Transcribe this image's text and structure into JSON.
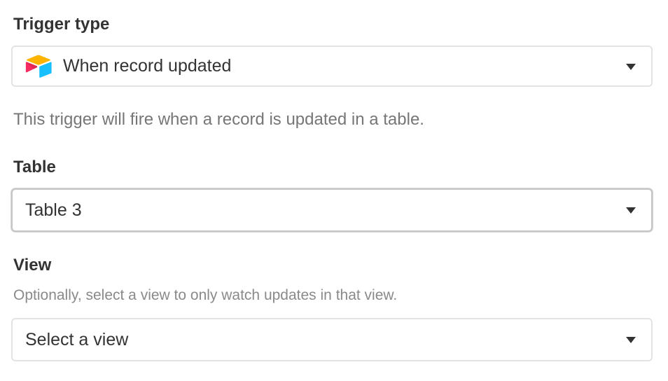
{
  "trigger": {
    "label": "Trigger type",
    "selected": "When record updated",
    "icon": "airtable-logo-icon",
    "description": "This trigger will fire when a record is updated in a table."
  },
  "table": {
    "label": "Table",
    "selected": "Table 3"
  },
  "view": {
    "label": "View",
    "description": "Optionally, select a view to only watch updates in that view.",
    "placeholder": "Select a view"
  },
  "colors": {
    "logo_yellow": "#FCB400",
    "logo_blue": "#18BFFF",
    "logo_red": "#F82B60",
    "caret": "#333333",
    "border": "#E3E3E3"
  }
}
